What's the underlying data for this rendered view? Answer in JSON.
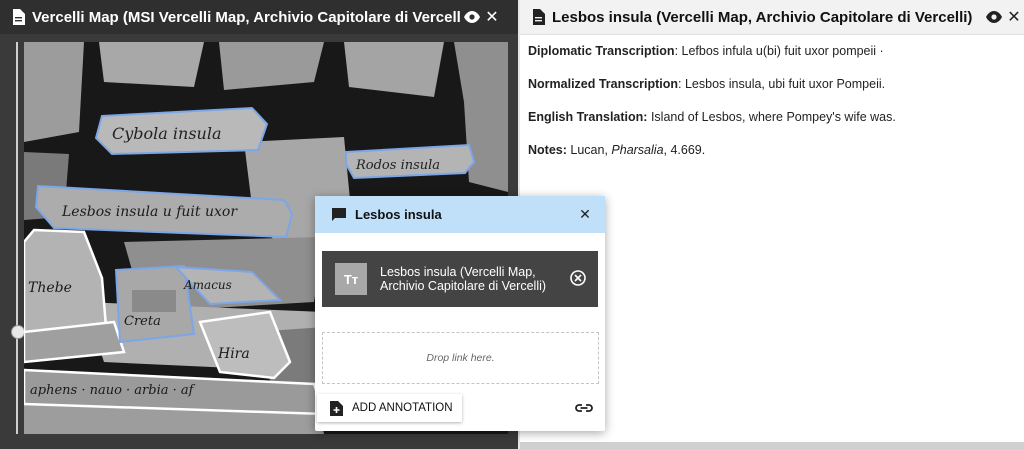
{
  "left_window": {
    "title": "Vercelli Map (MSI Vercelli Map, Archivio Capitolare di Vercelli)",
    "icons": [
      "document-icon",
      "eye-icon",
      "close-icon"
    ],
    "map_labels": [
      "Cybola insula",
      "Rodos insula",
      "Lesbos insula",
      "Thebe",
      "Creta",
      "Hira",
      "Amacus"
    ]
  },
  "right_window": {
    "title": "Lesbos insula (Vercelli Map, Archivio Capitolare di Vercelli)",
    "fields": [
      {
        "label": "Diplomatic Transcription",
        "value": "Lefbos infula u(bi) fuit uxor pompeii ·"
      },
      {
        "label": "Normalized Transcription",
        "value": "Lesbos insula, ubi fuit uxor Pompeii."
      },
      {
        "label": "English Translation:",
        "value": "Island of Lesbos, where Pompey's wife was."
      },
      {
        "label": "Notes:",
        "value_pre": "Lucan, ",
        "value_italic": "Pharsalia",
        "value_post": ", 4.669."
      }
    ]
  },
  "popup": {
    "title": "Lesbos insula",
    "link_icon_text": "Tт",
    "linked_item": "Lesbos insula (Vercelli Map, Archivio Capitolare di Vercelli)",
    "drop_text": "Drop link here.",
    "add_button": "ADD ANNOTATION"
  },
  "colors": {
    "popup_header": "#bfe0f8",
    "annotation_outline": "#7ba6e8",
    "selected_outline": "#ffffff"
  }
}
